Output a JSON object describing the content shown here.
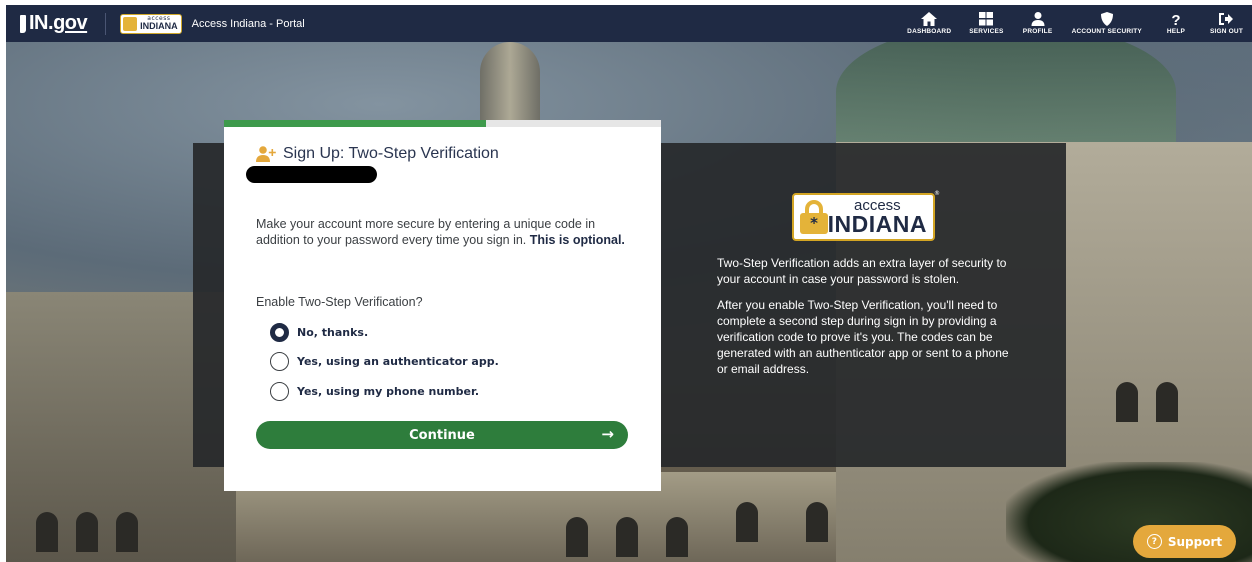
{
  "header": {
    "ingov_prefix": "IN.",
    "ingov_suffix": "gov",
    "logo_small_top": "access",
    "logo_small_bottom": "INDIANA",
    "portal_title": "Access Indiana - Portal",
    "nav": [
      {
        "label": "DASHBOARD",
        "icon": "home-icon"
      },
      {
        "label": "SERVICES",
        "icon": "grid-icon"
      },
      {
        "label": "PROFILE",
        "icon": "user-icon"
      },
      {
        "label": "ACCOUNT SECURITY",
        "icon": "shield-icon"
      },
      {
        "label": "HELP",
        "icon": "question-icon"
      },
      {
        "label": "SIGN OUT",
        "icon": "sign-out-icon"
      }
    ]
  },
  "card": {
    "progress_fraction": 0.6,
    "title": "Sign Up: Two-Step Verification",
    "intro_text": "Make your account more secure by entering a unique code in addition to your password every time you sign in.",
    "intro_bold": "This is optional.",
    "question": "Enable Two-Step Verification?",
    "options": [
      {
        "label": "No, thanks.",
        "selected": true
      },
      {
        "label": "Yes, using an authenticator app.",
        "selected": false
      },
      {
        "label": "Yes, using my phone number.",
        "selected": false
      }
    ],
    "continue_label": "Continue",
    "continue_arrow": "→"
  },
  "info": {
    "logo_top": "access",
    "logo_bottom": "INDIANA",
    "logo_lock_glyph": "*",
    "logo_reg": "®",
    "paragraph1": "Two-Step Verification adds an extra layer of security to your account in case your password is stolen.",
    "paragraph2": "After you enable Two-Step Verification, you'll need to complete a second step during sign in by providing a verification code to prove it's you. The codes can be generated with an authenticator app or sent to a phone or email address."
  },
  "support": {
    "label": "Support",
    "icon_glyph": "?"
  },
  "colors": {
    "nav_bg": "#1f2a44",
    "accent_green": "#2e7d3c",
    "progress_green": "#3e9a4c",
    "logo_gold": "#e4b339",
    "support_orange": "#e4a83c"
  }
}
